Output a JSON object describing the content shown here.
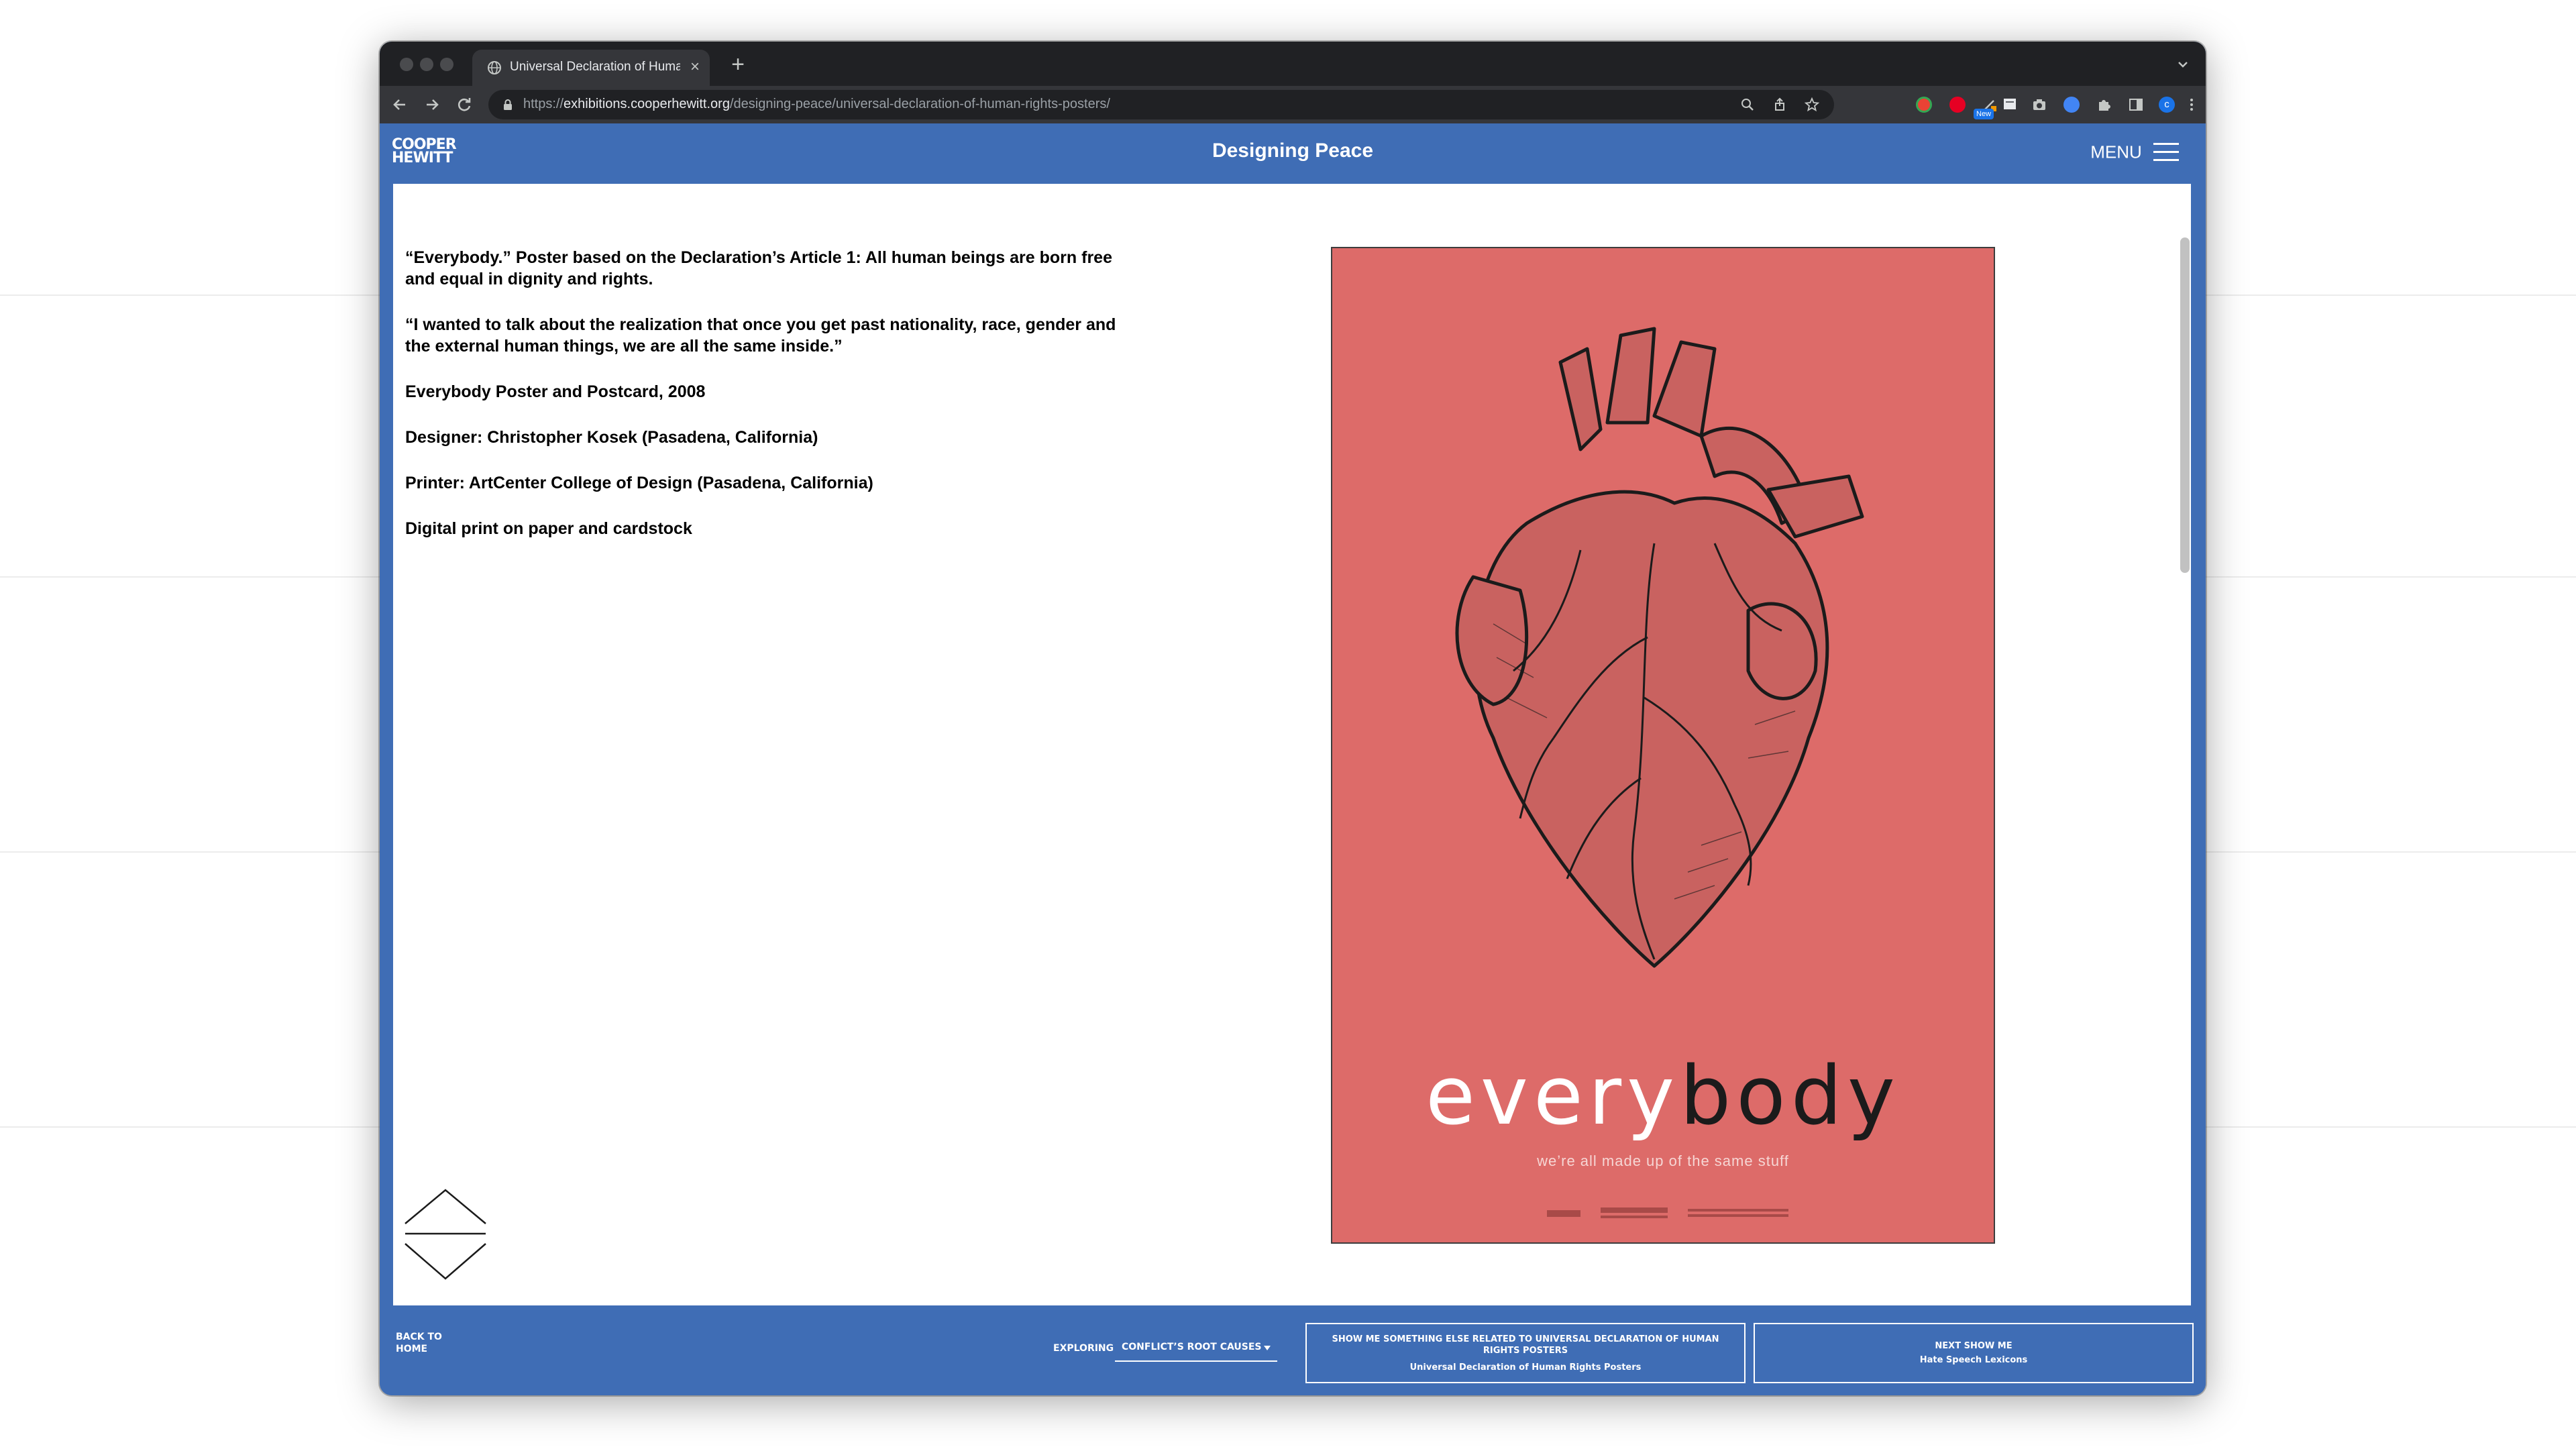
{
  "browser": {
    "tab_title": "Universal Declaration of Human Rights Posters",
    "url_scheme": "https://",
    "url_host": "exhibitions.cooperhewitt.org",
    "url_path": "/designing-peace/universal-declaration-of-human-rights-posters/",
    "ext_badge": "New"
  },
  "site": {
    "logo_line1": "COOPER",
    "logo_line2": "HEWITT",
    "title": "Designing Peace",
    "menu_label": "MENU"
  },
  "content": {
    "paragraphs": [
      "“Everybody.” Poster based on the Declaration’s Article 1: All human beings are born free and equal in dignity and rights.",
      "“I wanted to talk about the realization that once you get past nationality, race, gender and the external human things, we are all the same inside.”",
      "Everybody Poster and Postcard, 2008",
      "Designer: Christopher Kosek (Pasadena, California)",
      "Printer: ArtCenter College of Design (Pasadena, California)",
      "Digital print on paper and cardstock"
    ]
  },
  "poster": {
    "word_light": "every",
    "word_dark": "body",
    "tagline": "we’re all made up of the same stuff",
    "bg_color": "#dd6b69"
  },
  "footer": {
    "back_home_line1": "BACK TO",
    "back_home_line2": "HOME",
    "exploring_label": "EXPLORING",
    "exploring_value": "CONFLICT’S ROOT CAUSES",
    "related_line1": "SHOW ME SOMETHING ELSE RELATED TO UNIVERSAL DECLARATION OF HUMAN RIGHTS POSTERS",
    "related_line2": "Universal Declaration of Human Rights Posters",
    "next_line1": "NEXT SHOW ME",
    "next_line2": "Hate Speech Lexicons"
  },
  "colors": {
    "brand_blue": "#3f6db5",
    "chrome_dark": "#202124"
  }
}
